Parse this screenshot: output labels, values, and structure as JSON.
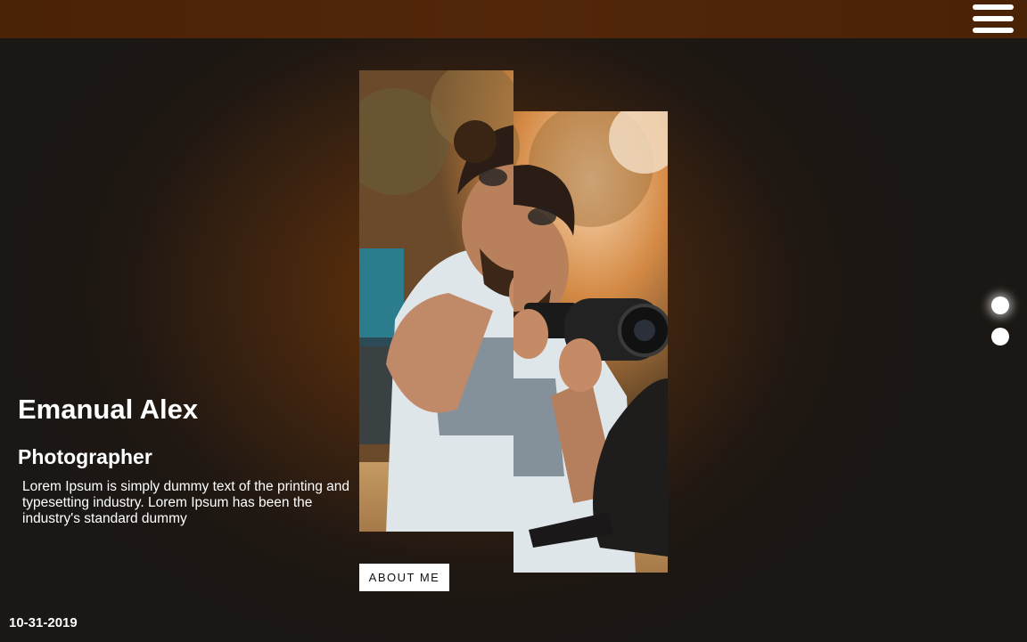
{
  "header": {
    "menu_icon": "hamburger-menu-icon"
  },
  "profile": {
    "name": "Emanual Alex",
    "role": "Photographer",
    "description": "Lorem Ipsum is simply dummy text of the printing and typesetting industry. Lorem Ipsum has been the industry's standard dummy"
  },
  "actions": {
    "about_label": "ABOUT ME"
  },
  "footer": {
    "date": "10-31-2019"
  },
  "slider": {
    "dot_count": 2,
    "active_index": 0
  },
  "colors": {
    "accent": "#6a3508",
    "header": "#4f240a",
    "background": "#1e1712"
  }
}
